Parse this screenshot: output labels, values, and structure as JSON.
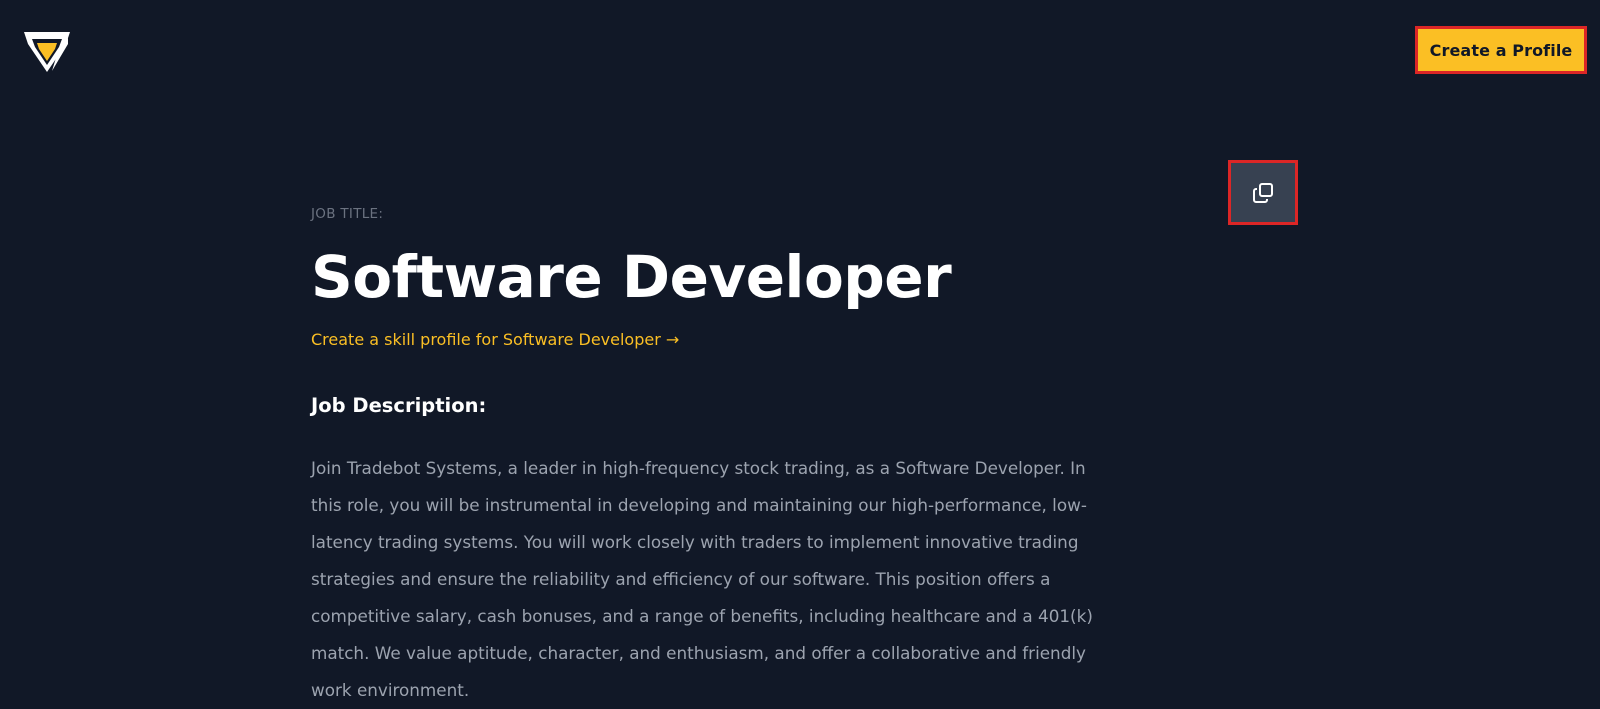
{
  "header": {
    "logo_icon": "shield-logo-icon",
    "create_profile_label": "Create a Profile"
  },
  "toolbar": {
    "copy_icon": "copy-icon"
  },
  "main": {
    "job_title_label": "JOB TITLE:",
    "job_title": "Software Developer",
    "skill_profile_link": "Create a skill profile for Software Developer →",
    "description_heading": "Job Description:",
    "description": "Join Tradebot Systems, a leader in high-frequency stock trading, as a Software Developer. In this role, you will be instrumental in developing and maintaining our high-performance, low-latency trading systems. You will work closely with traders to implement innovative trading strategies and ensure the reliability and efficiency of our software. This position offers a competitive salary, cash bonuses, and a range of benefits, including healthcare and a 401(k) match. We value aptitude, character, and enthusiasm, and offer a collaborative and friendly work environment."
  },
  "colors": {
    "background": "#111827",
    "accent": "#fbbf24",
    "highlight_border": "#dc2626",
    "muted_text": "#9ca3af"
  }
}
